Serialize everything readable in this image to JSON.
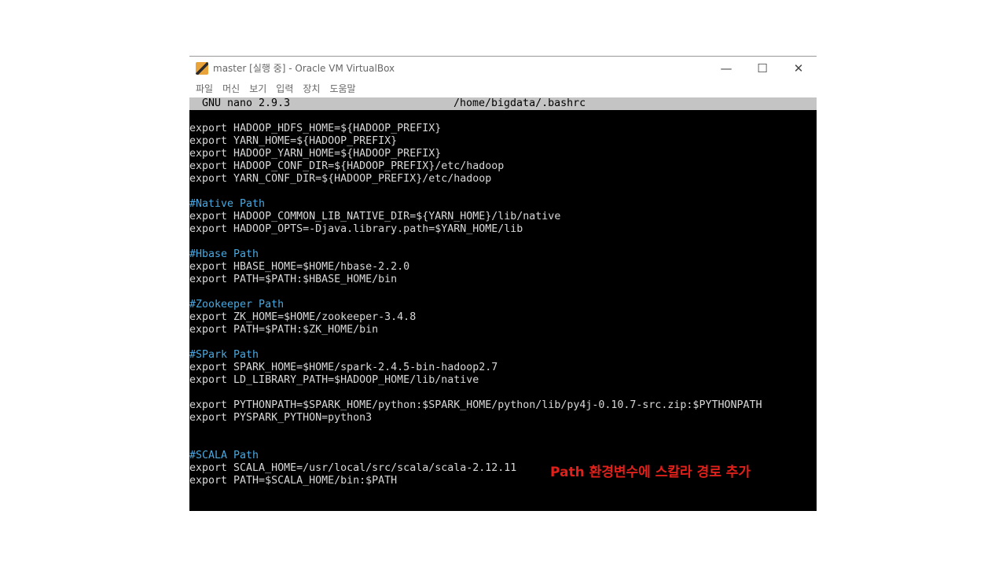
{
  "window": {
    "title": "master [실행 중] - Oracle VM VirtualBox",
    "controls": {
      "minimize": "—",
      "maximize": "☐",
      "close": "✕"
    }
  },
  "menu": [
    "파일",
    "머신",
    "보기",
    "입력",
    "장치",
    "도움말"
  ],
  "nano": {
    "version": "GNU nano 2.9.3",
    "file": "/home/bigdata/.bashrc"
  },
  "lines": [
    {
      "t": "export HADOOP_HDFS_HOME=${HADOOP_PREFIX}",
      "c": false
    },
    {
      "t": "export YARN_HOME=${HADOOP_PREFIX}",
      "c": false
    },
    {
      "t": "export HADOOP_YARN_HOME=${HADOOP_PREFIX}",
      "c": false
    },
    {
      "t": "export HADOOP_CONF_DIR=${HADOOP_PREFIX}/etc/hadoop",
      "c": false
    },
    {
      "t": "export YARN_CONF_DIR=${HADOOP_PREFIX}/etc/hadoop",
      "c": false
    },
    {
      "t": "",
      "c": false
    },
    {
      "t": "#Native Path",
      "c": true
    },
    {
      "t": "export HADOOP_COMMON_LIB_NATIVE_DIR=${YARN_HOME}/lib/native",
      "c": false
    },
    {
      "t": "export HADOOP_OPTS=-Djava.library.path=$YARN_HOME/lib",
      "c": false
    },
    {
      "t": "",
      "c": false
    },
    {
      "t": "#Hbase Path",
      "c": true
    },
    {
      "t": "export HBASE_HOME=$HOME/hbase-2.2.0",
      "c": false
    },
    {
      "t": "export PATH=$PATH:$HBASE_HOME/bin",
      "c": false
    },
    {
      "t": "",
      "c": false
    },
    {
      "t": "#Zookeeper Path",
      "c": true
    },
    {
      "t": "export ZK_HOME=$HOME/zookeeper-3.4.8",
      "c": false
    },
    {
      "t": "export PATH=$PATH:$ZK_HOME/bin",
      "c": false
    },
    {
      "t": "",
      "c": false
    },
    {
      "t": "#SPark Path",
      "c": true
    },
    {
      "t": "export SPARK_HOME=$HOME/spark-2.4.5-bin-hadoop2.7",
      "c": false
    },
    {
      "t": "export LD_LIBRARY_PATH=$HADOOP_HOME/lib/native",
      "c": false
    },
    {
      "t": "",
      "c": false
    },
    {
      "t": "export PYTHONPATH=$SPARK_HOME/python:$SPARK_HOME/python/lib/py4j-0.10.7-src.zip:$PYTHONPATH",
      "c": false
    },
    {
      "t": "export PYSPARK_PYTHON=python3",
      "c": false
    },
    {
      "t": "",
      "c": false
    },
    {
      "t": "",
      "c": false
    },
    {
      "t": "#SCALA Path",
      "c": true
    },
    {
      "t": "export SCALA_HOME=/usr/local/src/scala/scala-2.12.11",
      "c": false
    },
    {
      "t": "export PATH=$SCALA_HOME/bin:$PATH",
      "c": false
    }
  ],
  "annotation": "Path 환경변수에 스칼라 경로 추가",
  "colors": {
    "comment": "#4aa8e0",
    "annotation": "#e0201a",
    "terminal_bg": "#000000",
    "header_bg": "#c4c4c4"
  }
}
